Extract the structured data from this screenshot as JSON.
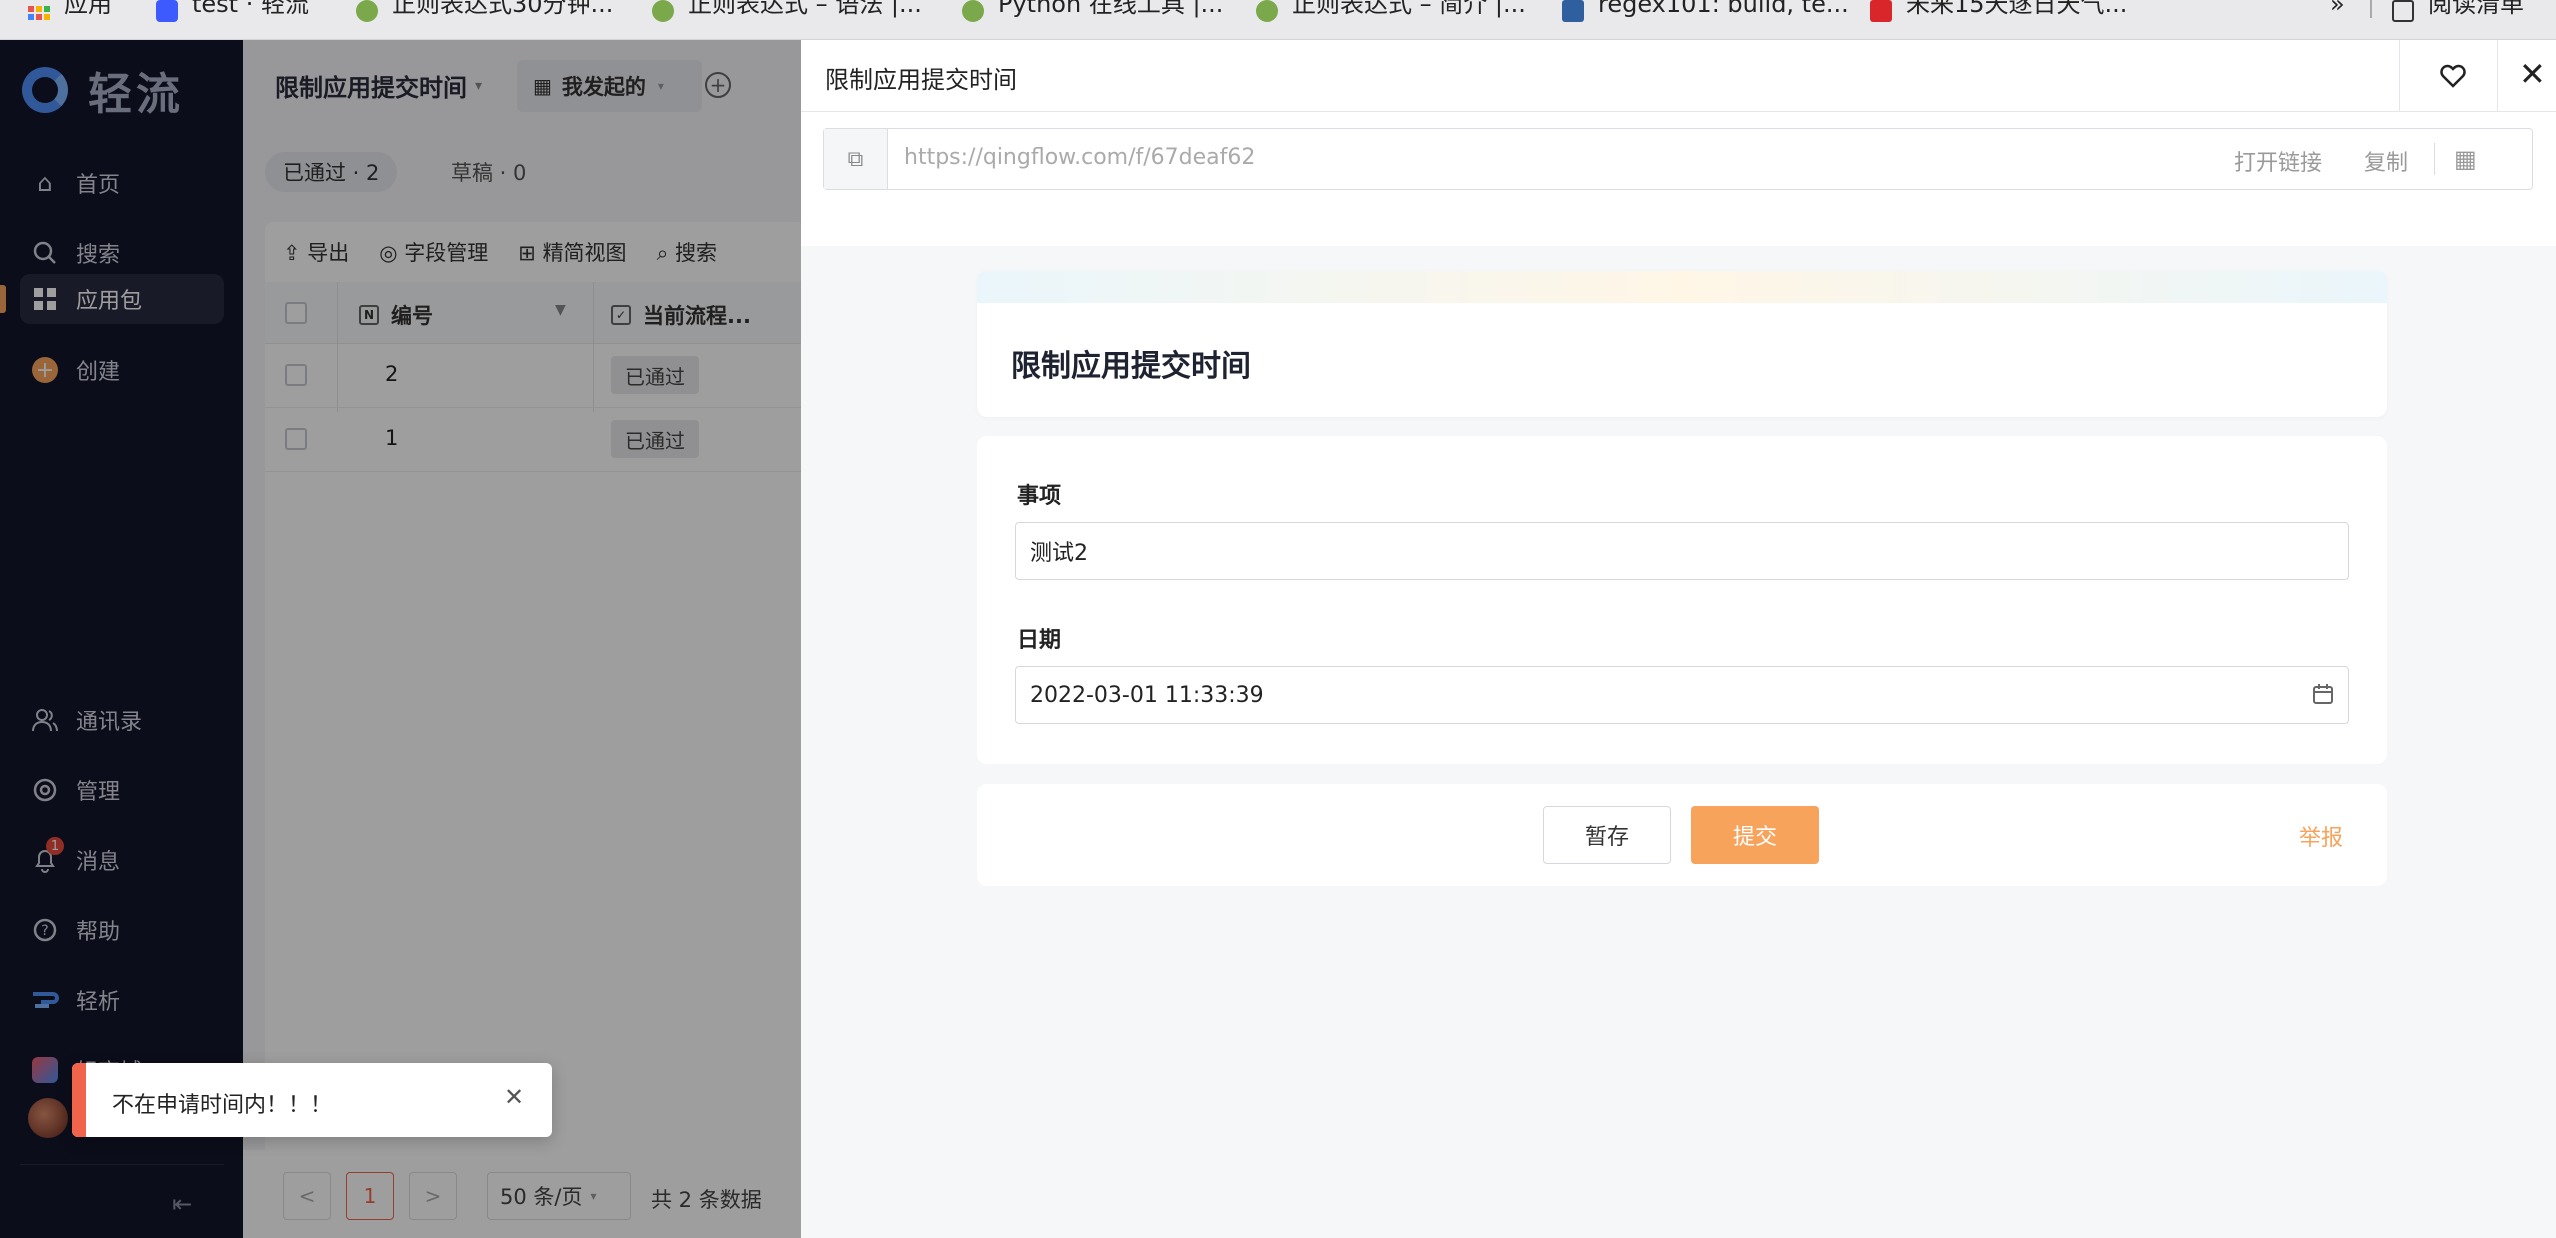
{
  "bookmarks": {
    "items": [
      {
        "label": "应用",
        "icon": "apps-grid-icon",
        "color": "#e8554e"
      },
      {
        "label": "test · 轻流",
        "icon": "qingflow-icon",
        "color": "#3d5afe"
      },
      {
        "label": "正则表达式30分钟...",
        "icon": "doc-icon",
        "color": "#7aa84b"
      },
      {
        "label": "正则表达式 – 语法 |...",
        "icon": "doc-icon",
        "color": "#7aa84b"
      },
      {
        "label": "Python 在线工具 |...",
        "icon": "doc-icon",
        "color": "#7aa84b"
      },
      {
        "label": "正则表达式 – 简介 |...",
        "icon": "doc-icon",
        "color": "#7aa84b"
      },
      {
        "label": "regex101: build, te...",
        "icon": "r-icon",
        "color": "#2f5f9e"
      },
      {
        "label": "未来15天逐日天气...",
        "icon": "weather-icon",
        "color": "#d9262b"
      }
    ],
    "more": "»",
    "reading_list": "阅读清单"
  },
  "sidebar": {
    "logo_text": "轻流",
    "items": [
      {
        "label": "首页",
        "icon": "home-icon"
      },
      {
        "label": "搜索",
        "icon": "search-icon"
      },
      {
        "label": "应用包",
        "icon": "app-package-icon"
      },
      {
        "label": "创建",
        "icon": "add-icon"
      },
      {
        "label": "通讯录",
        "icon": "contacts-icon"
      },
      {
        "label": "管理",
        "icon": "settings-icon"
      },
      {
        "label": "消息",
        "icon": "bell-icon",
        "badge": "1"
      },
      {
        "label": "帮助",
        "icon": "help-icon"
      },
      {
        "label": "轻析",
        "icon": "analytics-icon"
      },
      {
        "label": "轻商城",
        "icon": "store-icon"
      }
    ]
  },
  "main": {
    "title": "限制应用提交时间",
    "view_tab": "我发起的",
    "status_tabs": [
      {
        "label": "已通过 · 2"
      },
      {
        "label": "草稿 · 0"
      }
    ],
    "toolbar": [
      "导出",
      "字段管理",
      "精简视图",
      "搜索"
    ],
    "columns": [
      "编号",
      "当前流程..."
    ],
    "rows": [
      {
        "id": "2",
        "status": "已通过"
      },
      {
        "id": "1",
        "status": "已通过"
      }
    ],
    "pagination": {
      "prev": "<",
      "page": "1",
      "next": ">",
      "page_size": "50 条/页",
      "total": "共 2 条数据"
    }
  },
  "drawer": {
    "title": "限制应用提交时间",
    "url": "https://qingflow.com/f/67deaf62",
    "open_link": "打开链接",
    "copy": "复制",
    "form_title": "限制应用提交时间",
    "fields": [
      {
        "label": "事项",
        "value": "测试2"
      },
      {
        "label": "日期",
        "value": "2022-03-01 11:33:39"
      }
    ],
    "save_label": "暂存",
    "submit_label": "提交",
    "report_label": "举报",
    "accent": "#f7a35c"
  },
  "toast": {
    "message": "不在申请时间内！！！",
    "color": "#f0644b"
  }
}
